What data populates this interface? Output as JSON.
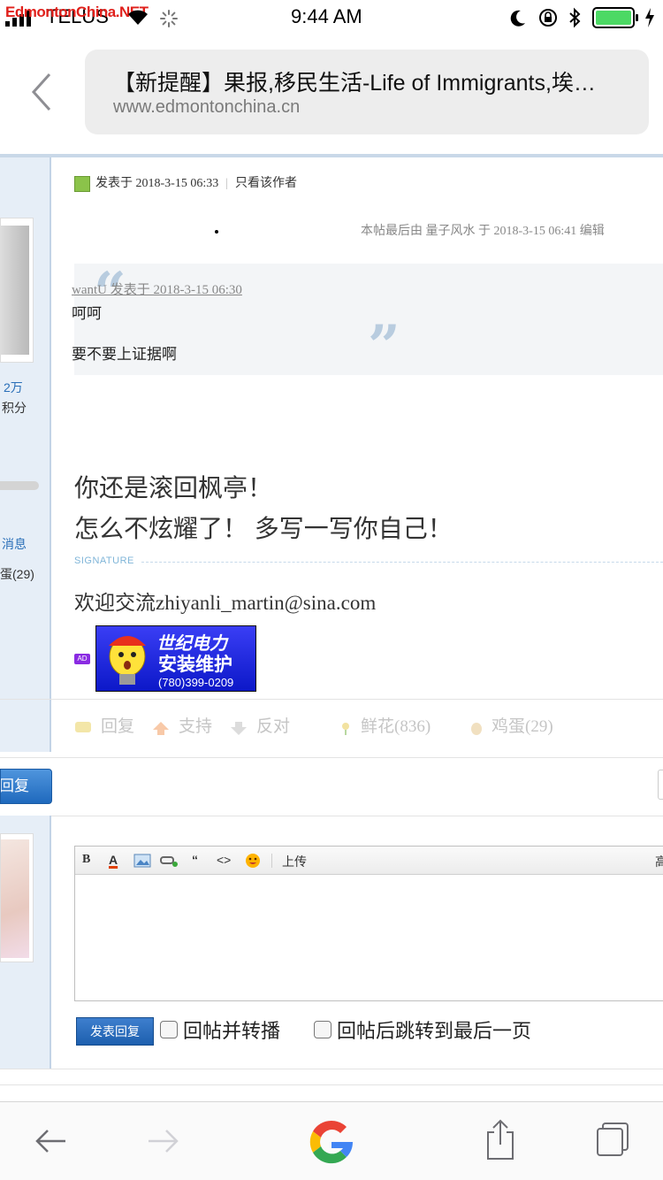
{
  "status_bar": {
    "carrier": "TELUS",
    "watermark": "EdmontonChina.NET",
    "time": "9:44 AM"
  },
  "header": {
    "page_title": "【新提醒】果报,移民生活-Life of Immigrants,埃…",
    "domain": "www.edmontonchina.cn"
  },
  "sidebar": {
    "stat_value": "2万",
    "stat_label": "积分",
    "messages_link": "消息",
    "eggs_link": "蛋(29)",
    "reply_button": "回复"
  },
  "post": {
    "posted_at": "发表于 2018-3-15 06:33",
    "author_only": "只看该作者",
    "edit_note": "本帖最后由 量子风水 于 2018-3-15 06:41 编辑",
    "quote": {
      "author_line": "wantU 发表于 2018-3-15 06:30",
      "line1": "呵呵",
      "line2": "要不要上证据啊"
    },
    "body_line1": "你还是滚回枫亭！",
    "body_line2": "怎么不炫耀了！  多写一写你自己！",
    "signature_label": "SIGNATURE",
    "signature_text": "欢迎交流zhiyanli_martin@sina.com",
    "ad_badge": "AD",
    "ad": {
      "title1": "世纪电力",
      "title2": "安装维护",
      "phone": "(780)399-0209"
    },
    "actions": {
      "reply": "回复",
      "support": "支持",
      "oppose": "反对",
      "flowers": "鲜花(836)",
      "eggs": "鸡蛋(29)"
    }
  },
  "reply_form": {
    "toolbar": {
      "bold": "B",
      "font_color": "A",
      "quote": "“",
      "code": "<>",
      "upload": "上传",
      "advanced": "高"
    },
    "editor_value": "",
    "submit": "发表回复",
    "option1": "回帖并转播",
    "option2": "回帖后跳转到最后一页"
  },
  "colors": {
    "link_blue": "#2a6fb8",
    "button_blue": "#1f69bd",
    "sidebar_bg": "#e6eef7",
    "battery_green": "#4cd964"
  }
}
